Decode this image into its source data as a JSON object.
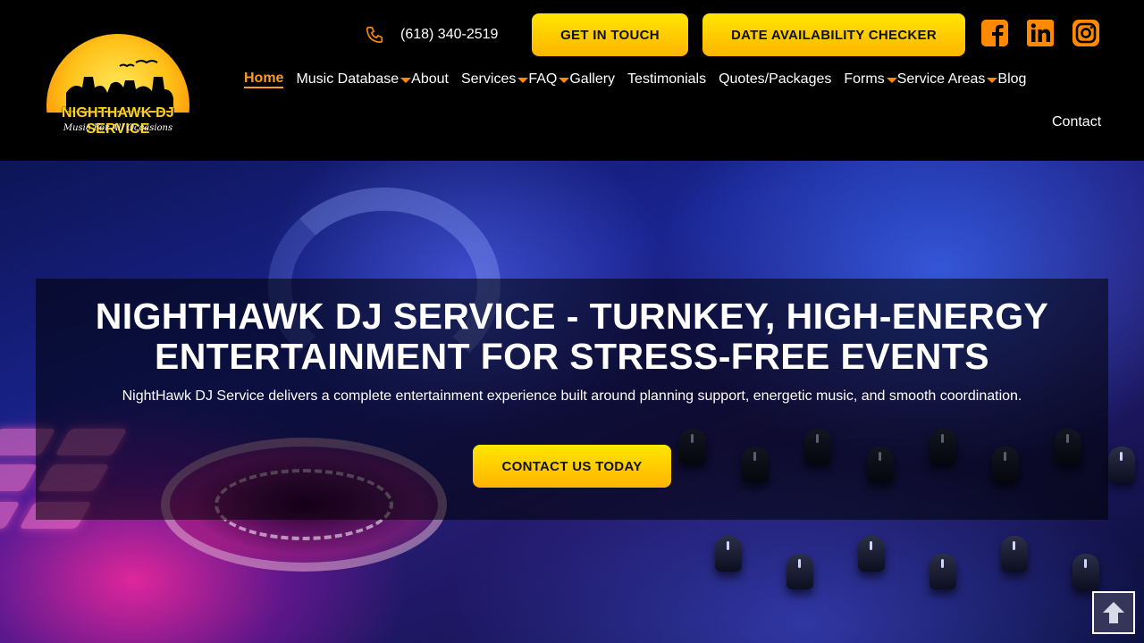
{
  "brand": {
    "name": "NIGHTHAWK DJ SERVICE",
    "tagline": "Music For All Occasions"
  },
  "header": {
    "phone": "(618) 340-2519",
    "get_in_touch": "GET IN TOUCH",
    "date_checker": "DATE AVAILABILITY CHECKER",
    "social": [
      "facebook-icon",
      "linkedin-icon",
      "instagram-icon"
    ]
  },
  "nav": {
    "home": "Home",
    "music_database": "Music Database",
    "about": "About",
    "services": "Services",
    "faq": "FAQ",
    "gallery": "Gallery",
    "testimonials": "Testimonials",
    "quotes": "Quotes/Packages",
    "forms": "Forms",
    "service_areas": "Service Areas",
    "blog": "Blog",
    "contact": "Contact"
  },
  "hero": {
    "title": "NIGHTHAWK DJ SERVICE - TURNKEY, HIGH-ENERGY ENTERTAINMENT FOR STRESS-FREE EVENTS",
    "subtitle": "NightHawk DJ Service delivers a complete entertainment experience built around planning support, energetic music, and smooth coordination.",
    "cta": "CONTACT US TODAY"
  },
  "colors": {
    "accent": "#ff9a1f",
    "button_top": "#ffe600",
    "button_bottom": "#ffb400",
    "header_bg": "#000000"
  }
}
